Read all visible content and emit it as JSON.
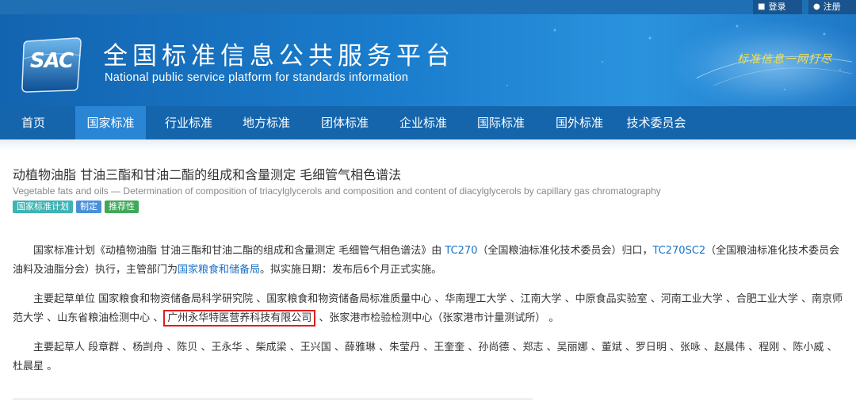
{
  "topbar": {
    "login_label": "登录",
    "register_label": "注册"
  },
  "header": {
    "logo_text": "SAC",
    "title_cn": "全国标准信息公共服务平台",
    "title_en": "National public service platform  for standards information",
    "slogan": "标准信息一网打尽"
  },
  "nav": {
    "items": [
      {
        "label": "首页"
      },
      {
        "label": "国家标准"
      },
      {
        "label": "行业标准"
      },
      {
        "label": "地方标准"
      },
      {
        "label": "团体标准"
      },
      {
        "label": "企业标准"
      },
      {
        "label": "国际标准"
      },
      {
        "label": "国外标准"
      },
      {
        "label": "技术委员会"
      }
    ],
    "active_index": 1
  },
  "standard": {
    "title_cn": "动植物油脂 甘油三酯和甘油二酯的组成和含量测定 毛细管气相色谱法",
    "title_en": "Vegetable fats and oils — Determination of composition of triacylglycerols and composition and content of diacylglycerols by capillary gas chromatography",
    "tags": [
      "国家标准计划",
      "制定",
      "推荐性"
    ]
  },
  "paragraph1": {
    "t1": "国家标准计划《动植物油脂 甘油三酯和甘油二酯的组成和含量测定 毛细管气相色谱法》由 ",
    "link1": "TC270",
    "t2": "（全国粮油标准化技术委员会）归口，",
    "link2": "TC270SC2",
    "t3": "（全国粮油标准化技术委员会油料及油脂分会）执行，主管部门为",
    "link3": "国家粮食和储备局",
    "t4": "。拟实施日期：发布后6个月正式实施。"
  },
  "paragraph2": {
    "t1": "主要起草单位 国家粮食和物资储备局科学研究院 、国家粮食和物资储备局标准质量中心 、华南理工大学 、江南大学 、中原食品实验室 、河南工业大学 、合肥工业大学 、南京师范大学 、山东省粮油检测中心 、",
    "highlight": "广州永华特医营养科技有限公司",
    "t2": " 、张家港市检验检测中心（张家港市计量测试所） 。"
  },
  "paragraph3": {
    "text": "主要起草人 段章群 、杨剀舟 、陈贝 、王永华 、柴成梁 、王兴国 、薛雅琳 、朱莹丹 、王奎奎 、孙尚德 、郑志 、吴丽娜 、董斌 、罗日明 、张咏 、赵晨伟 、程刚 、陈小威 、杜晨星 。"
  },
  "colors": {
    "banner_blue": "#1a7ccc",
    "nav_blue": "#1565ac",
    "nav_active": "#2a86d4",
    "link": "#1a73c8",
    "highlight_border": "#e01d1d"
  }
}
